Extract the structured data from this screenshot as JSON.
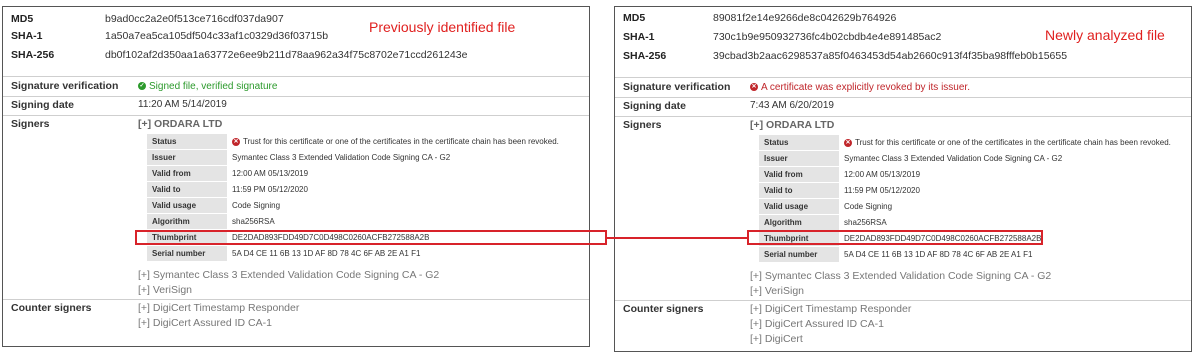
{
  "left": {
    "title": "Previously identified file",
    "md5_label": "MD5",
    "md5": "b9ad0cc2a2e0f513ce716cdf037da907",
    "sha1_label": "SHA-1",
    "sha1": "1a50a7ea5ca105df504c33af1c0329d36f03715b",
    "sha256_label": "SHA-256",
    "sha256": "db0f102af2d350aa1a63772e6ee9b211d78aa962a34f75c8702e71ccd261243e",
    "sigver_label": "Signature verification",
    "sigver_value": "Signed file, verified signature",
    "signdate_label": "Signing date",
    "signdate_value": "11:20 AM 5/14/2019",
    "signers_label": "Signers",
    "signer_name": "[+] ORDARA LTD",
    "details": {
      "status_label": "Status",
      "status_value": "Trust for this certificate or one of the certificates in the certificate chain has been revoked.",
      "issuer_label": "Issuer",
      "issuer_value": "Symantec Class 3 Extended Validation Code Signing CA - G2",
      "validfrom_label": "Valid from",
      "validfrom_value": "12:00 AM 05/13/2019",
      "validto_label": "Valid to",
      "validto_value": "11:59 PM 05/12/2020",
      "usage_label": "Valid usage",
      "usage_value": "Code Signing",
      "algo_label": "Algorithm",
      "algo_value": "sha256RSA",
      "thumb_label": "Thumbprint",
      "thumb_value": "DE2DAD893FDD49D7C0D498C0260ACFB272588A2B",
      "serial_label": "Serial number",
      "serial_value": "5A D4 CE 11 6B 13 1D AF 8D 78 4C 6F AB 2E A1 F1"
    },
    "chain": [
      "[+] Symantec Class 3 Extended Validation Code Signing CA - G2",
      "[+] VeriSign"
    ],
    "counter_label": "Counter signers",
    "counter": [
      "[+] DigiCert Timestamp Responder",
      "[+] DigiCert Assured ID CA-1"
    ]
  },
  "right": {
    "title": "Newly analyzed file",
    "md5_label": "MD5",
    "md5": "89081f2e14e9266de8c042629b764926",
    "sha1_label": "SHA-1",
    "sha1": "730c1b9e950932736fc4b02cbdb4e4e891485ac2",
    "sha256_label": "SHA-256",
    "sha256": "39cbad3b2aac6298537a85f0463453d54ab2660c913f4f35ba98fffeb0b15655",
    "sigver_label": "Signature verification",
    "sigver_value": "A certificate was explicitly revoked by its issuer.",
    "signdate_label": "Signing date",
    "signdate_value": "7:43 AM 6/20/2019",
    "signers_label": "Signers",
    "signer_name": "[+] ORDARA LTD",
    "details": {
      "status_label": "Status",
      "status_value": "Trust for this certificate or one of the certificates in the certificate chain has been revoked.",
      "issuer_label": "Issuer",
      "issuer_value": "Symantec Class 3 Extended Validation Code Signing CA - G2",
      "validfrom_label": "Valid from",
      "validfrom_value": "12:00 AM 05/13/2019",
      "validto_label": "Valid to",
      "validto_value": "11:59 PM 05/12/2020",
      "usage_label": "Valid usage",
      "usage_value": "Code Signing",
      "algo_label": "Algorithm",
      "algo_value": "sha256RSA",
      "thumb_label": "Thumbprint",
      "thumb_value": "DE2DAD893FDD49D7C0D498C0260ACFB272588A2B",
      "serial_label": "Serial number",
      "serial_value": "5A D4 CE 11 6B 13 1D AF 8D 78 4C 6F AB 2E A1 F1"
    },
    "chain": [
      "[+] Symantec Class 3 Extended Validation Code Signing CA - G2",
      "[+] VeriSign"
    ],
    "counter_label": "Counter signers",
    "counter": [
      "[+] DigiCert Timestamp Responder",
      "[+] DigiCert Assured ID CA-1",
      "[+] DigiCert"
    ]
  },
  "colors": {
    "highlight": "#d8232a",
    "title": "#e0201f",
    "ok": "#2c9a2c",
    "error": "#c0262b"
  },
  "icons": {
    "ok": "check-circle-icon",
    "error": "x-circle-icon"
  }
}
